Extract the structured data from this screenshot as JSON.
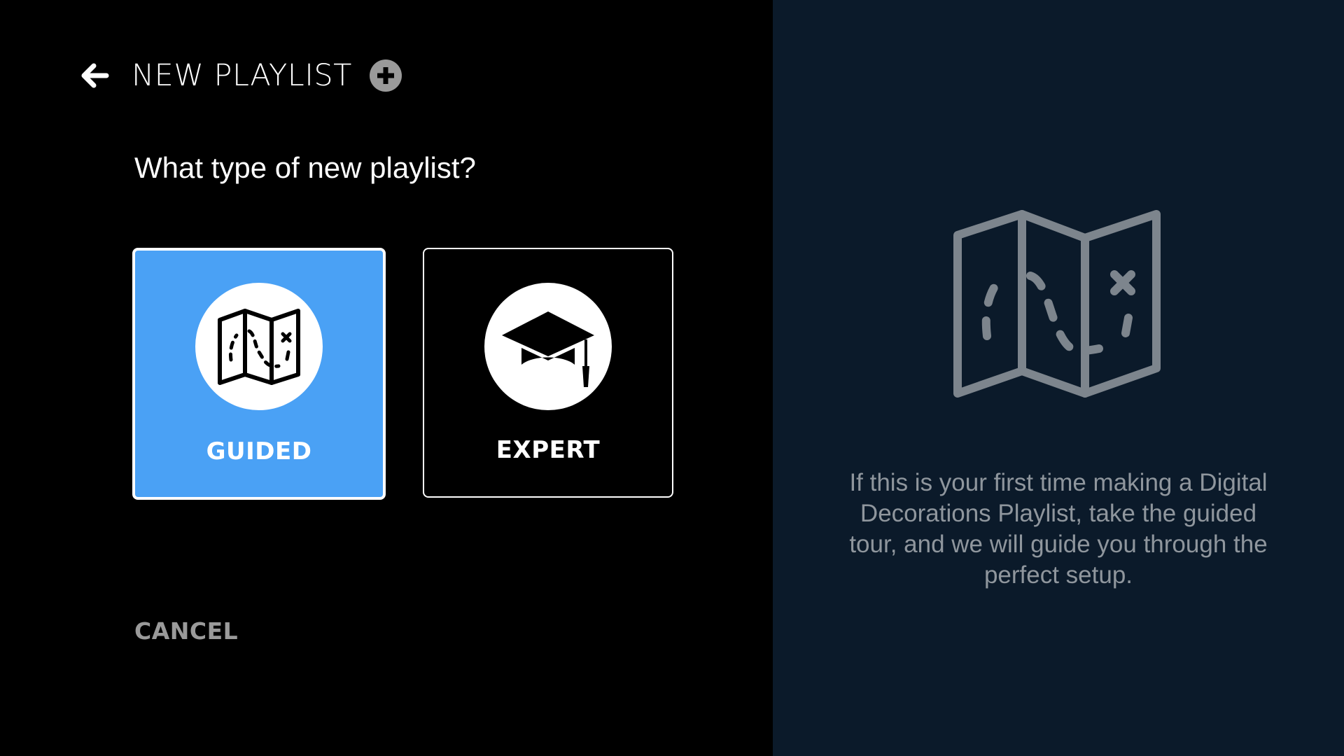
{
  "header": {
    "title": "NEW PLAYLIST",
    "back_icon": "arrow-left-icon",
    "add_icon": "plus-circle-icon"
  },
  "question": "What type of new playlist?",
  "options": [
    {
      "label": "GUIDED",
      "icon": "map-icon",
      "selected": true
    },
    {
      "label": "EXPERT",
      "icon": "graduation-cap-icon",
      "selected": false
    }
  ],
  "cancel_label": "CANCEL",
  "info_panel": {
    "icon": "map-icon",
    "description": "If this is your first time making a Digital Decorations Playlist, take the guided tour, and we will guide you through the perfect setup."
  },
  "colors": {
    "left_background": "#000000",
    "right_background": "#0b1a2a",
    "selected_option": "#4aa1f5",
    "muted_text": "#8f969d",
    "cancel_text": "#9a9a9a"
  }
}
